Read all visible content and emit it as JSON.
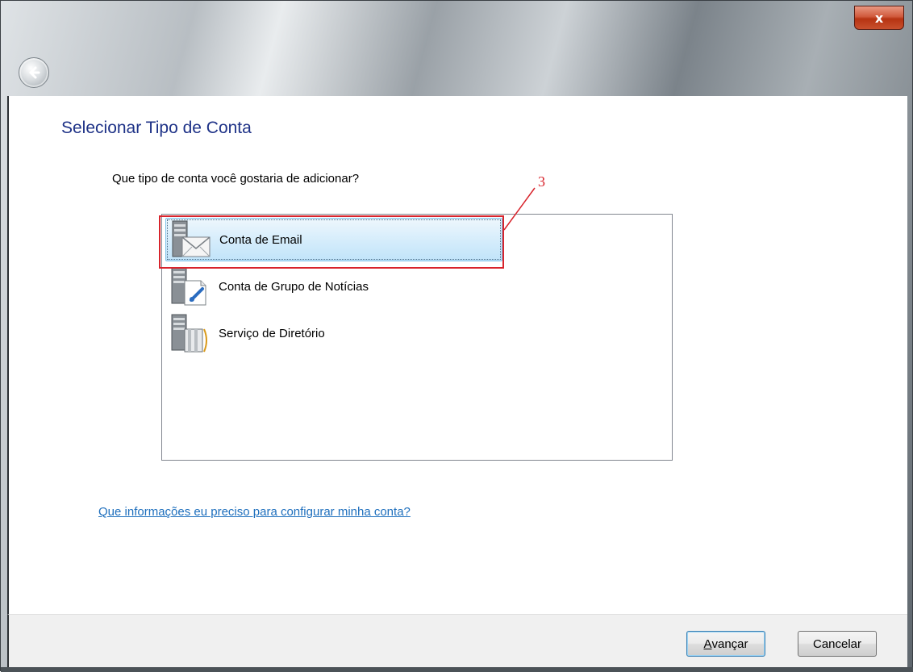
{
  "window": {
    "close_label": "x"
  },
  "page": {
    "title": "Selecionar Tipo de Conta",
    "question": "Que tipo de conta você gostaria de adicionar?"
  },
  "account_types": {
    "items": [
      {
        "label": "Conta de Email",
        "icon": "email-server-icon",
        "selected": true
      },
      {
        "label": "Conta de Grupo de Notícias",
        "icon": "newsgroup-server-icon",
        "selected": false
      },
      {
        "label": "Serviço de Diretório",
        "icon": "directory-server-icon",
        "selected": false
      }
    ]
  },
  "annotation": {
    "number": "3",
    "color": "#d8242c"
  },
  "help_link": "Que informações eu preciso para configurar minha conta?",
  "footer": {
    "next_label_accel": "A",
    "next_label_rest": "vançar",
    "cancel_label": "Cancelar"
  },
  "colors": {
    "title": "#1e3287",
    "link": "#1e6fbd",
    "selection": "#c1e4fa"
  }
}
